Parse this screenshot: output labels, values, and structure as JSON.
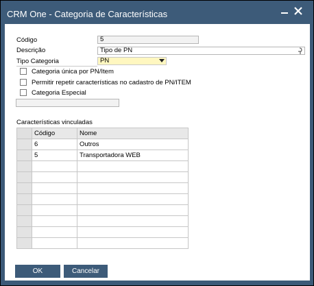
{
  "window": {
    "title": "CRM One - Categoria de Características",
    "minimize_glyph": "▁",
    "close_glyph": "✕"
  },
  "form": {
    "codigo_label": "Código",
    "codigo_value": "5",
    "descricao_label": "Descrição",
    "descricao_value": "Tipo de PN",
    "tipo_label": "Tipo Categoria",
    "tipo_value": "PN",
    "check1_label": "Categoria única por PN/Item",
    "check2_label": "Permitir repetir características no cadastro de PN/ITEM",
    "check3_label": "Categoria Especial",
    "extra_value": ""
  },
  "section": {
    "title": "Características vinculadas"
  },
  "table": {
    "headers": {
      "codigo": "Código",
      "nome": "Nome"
    },
    "rows": [
      {
        "codigo": "6",
        "nome": "Outros"
      },
      {
        "codigo": "5",
        "nome": "Transportadora WEB"
      },
      {
        "codigo": "",
        "nome": ""
      },
      {
        "codigo": "",
        "nome": ""
      },
      {
        "codigo": "",
        "nome": ""
      },
      {
        "codigo": "",
        "nome": ""
      },
      {
        "codigo": "",
        "nome": ""
      },
      {
        "codigo": "",
        "nome": ""
      },
      {
        "codigo": "",
        "nome": ""
      },
      {
        "codigo": "",
        "nome": ""
      }
    ]
  },
  "buttons": {
    "ok": "OK",
    "cancel": "Cancelar"
  },
  "colors": {
    "frame": "#3d5b79",
    "required_field": "#fff7c0"
  },
  "icons": {
    "descricao_field_icon": "link-arrow-icon",
    "tipo_dropdown_icon": "chevron-down-icon"
  }
}
